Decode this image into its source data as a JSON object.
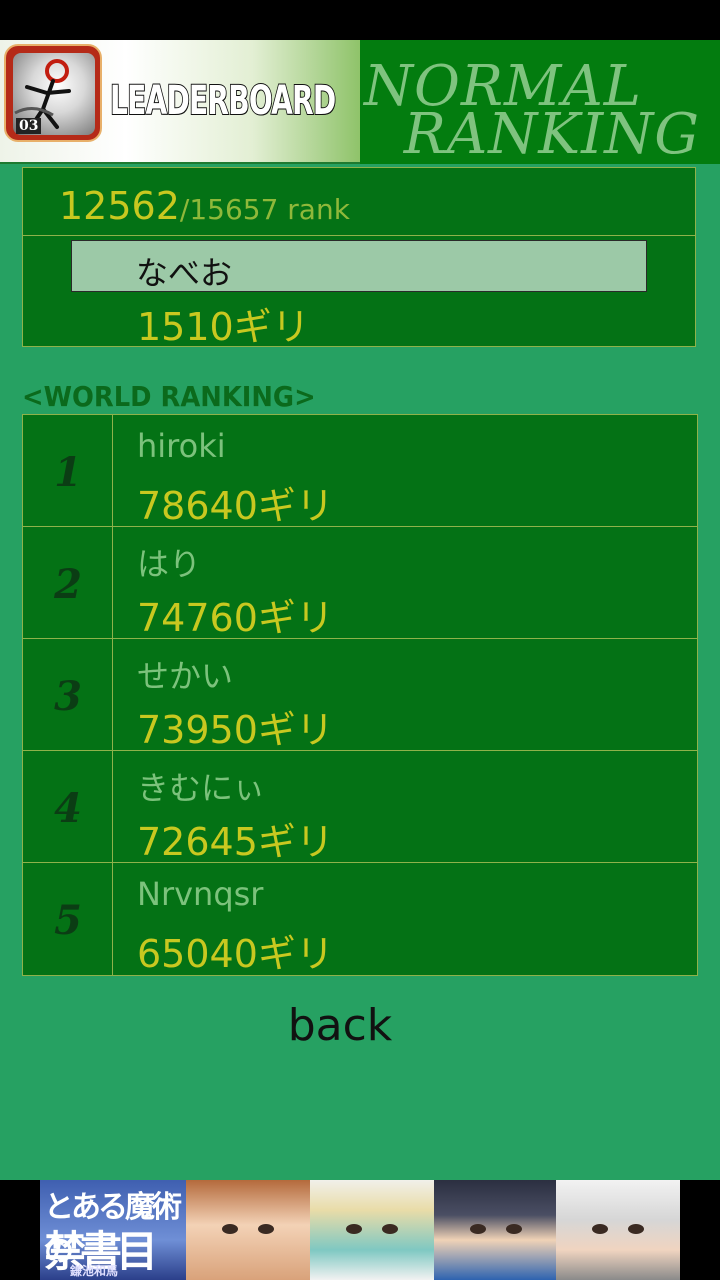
{
  "header": {
    "badge_number": "03",
    "leaderboard_label": "LEADERBOARD",
    "mode_line1": "NORMAL",
    "mode_line2": "RANKING"
  },
  "my_rank": {
    "rank": "12562",
    "total": "/15657 rank",
    "name": "なべお",
    "score": "1510ギリ"
  },
  "world_ranking": {
    "label": "<WORLD RANKING>",
    "rows": [
      {
        "rank": "1",
        "name": "hiroki",
        "score": "78640ギリ"
      },
      {
        "rank": "2",
        "name": "はり",
        "score": "74760ギリ"
      },
      {
        "rank": "3",
        "name": "せかい",
        "score": "73950ギリ"
      },
      {
        "rank": "4",
        "name": "きむにぃ",
        "score": "72645ギリ"
      },
      {
        "rank": "5",
        "name": "Nrvnqsr",
        "score": "65040ギリ"
      }
    ]
  },
  "back_label": "back",
  "ad": {
    "title_line1": "とある魔術の",
    "title_line2": "禁書目録",
    "title_line3": "鎌池和馬"
  },
  "colors": {
    "background": "#26a162",
    "panel": "#047215",
    "score": "#c8c820",
    "name": "#7cc27c"
  }
}
